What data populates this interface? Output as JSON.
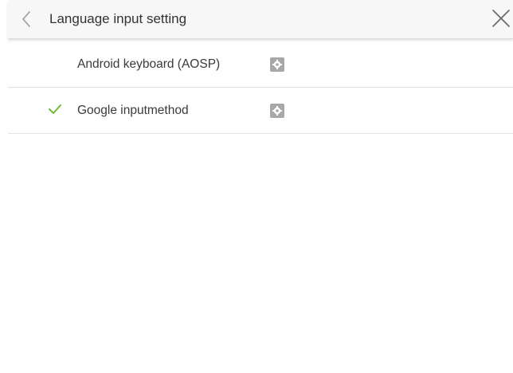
{
  "header": {
    "title": "Language input setting",
    "back_icon": "chevron-left-icon",
    "close_icon": "close-icon"
  },
  "input_methods": [
    {
      "label": "Android keyboard (AOSP)",
      "selected": false,
      "settings_icon": "gear-icon"
    },
    {
      "label": "Google inputmethod",
      "selected": true,
      "settings_icon": "gear-icon"
    }
  ],
  "colors": {
    "check": "#6fb83a",
    "header_bg": "#f7f7f7",
    "settings_bg": "#a8a8a8"
  }
}
